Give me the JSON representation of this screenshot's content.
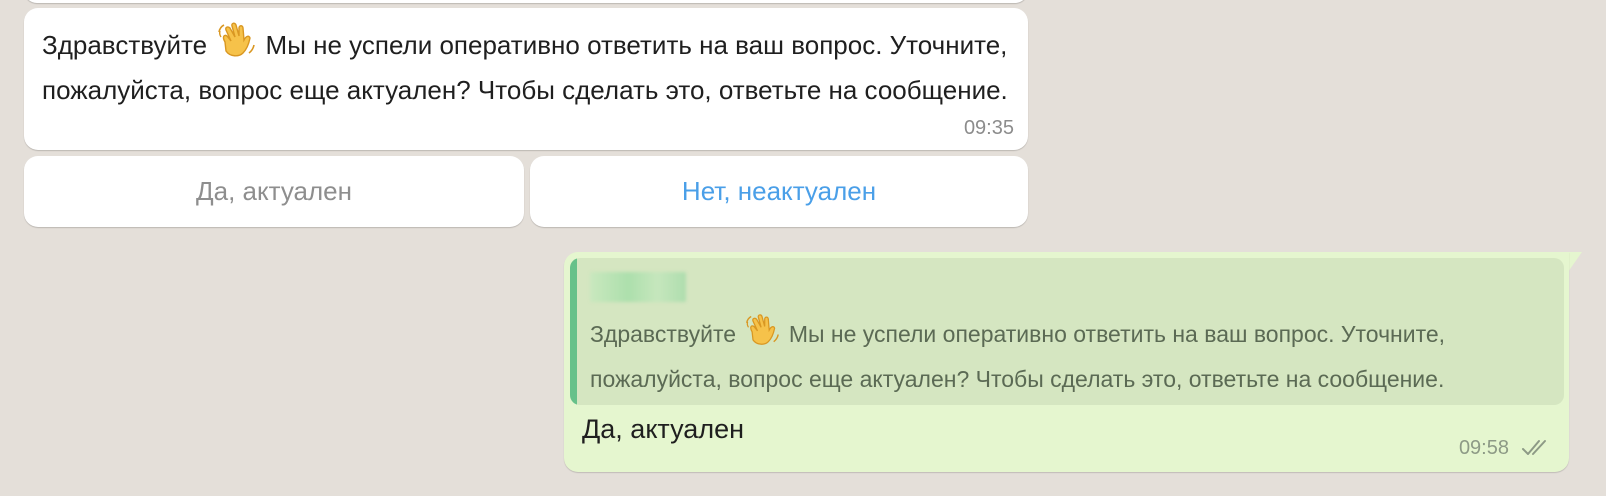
{
  "incoming": {
    "text_before_emoji": "Здравствуйте",
    "text_after_emoji": "Мы не успели оперативно ответить на ваш вопрос. Уточните, пожалуйста, вопрос еще актуален? Чтобы сделать это, ответьте на сообщение.",
    "time": "09:35",
    "emoji": "waving-hand-icon"
  },
  "keyboard": {
    "yes_label": "Да, актуален",
    "no_label": "Нет, неактуален"
  },
  "outgoing": {
    "quote": {
      "author_blurred": true,
      "text_before_emoji": "Здравствуйте",
      "text_after_emoji": "Мы не успели оперативно ответить на ваш вопрос. Уточните, пожалуйста, вопрос еще актуален? Чтобы сделать это, ответьте на сообщение."
    },
    "text": "Да, актуален",
    "time": "09:58",
    "status_icon": "double-check-icon"
  },
  "colors": {
    "background": "#e4dfd9",
    "incoming_bubble": "#ffffff",
    "outgoing_bubble": "#e5f6cf",
    "quote_bg": "#d5e6c1",
    "quote_bar": "#67c18a",
    "link_blue": "#4a9fe8"
  }
}
